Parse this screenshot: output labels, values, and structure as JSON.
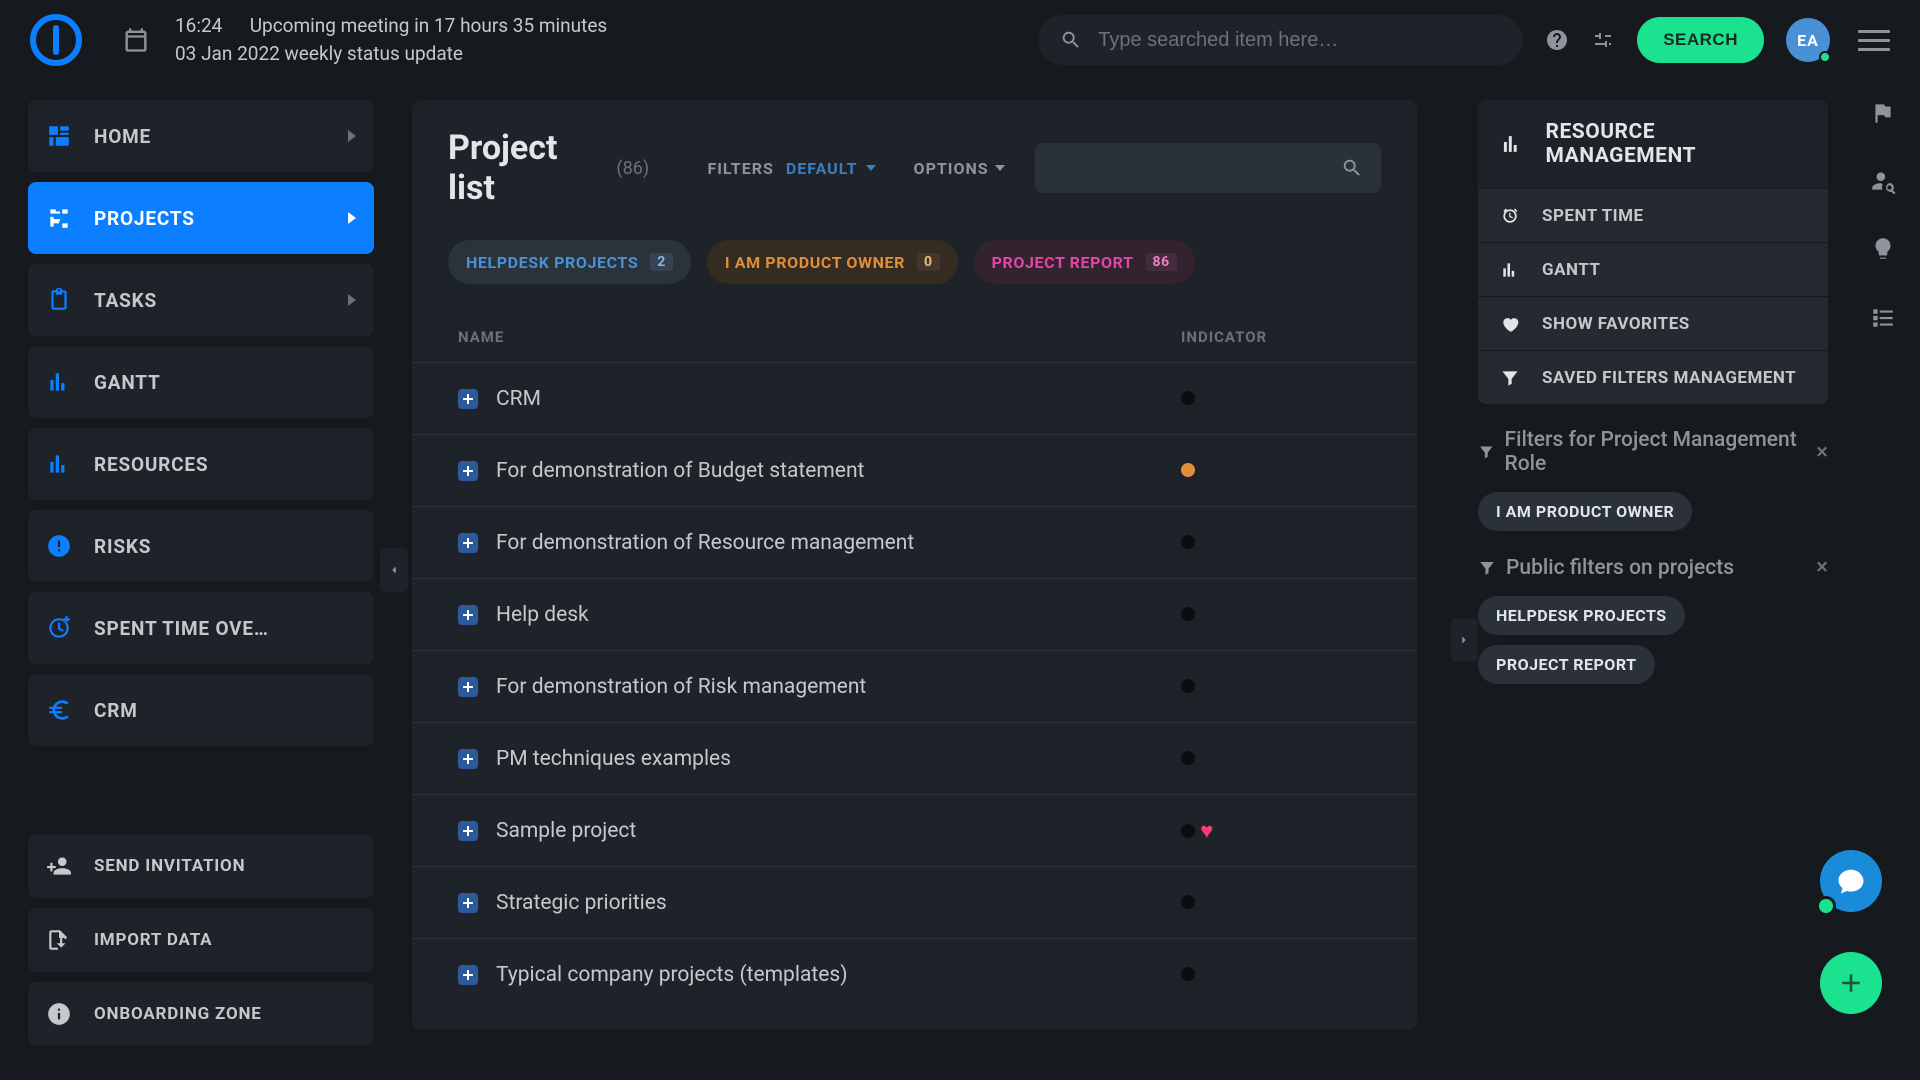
{
  "header": {
    "time": "16:24",
    "upcoming_label": "Upcoming meeting in 17 hours 35 minutes",
    "date": "03 Jan 2022",
    "meeting_title": "weekly status update",
    "search_placeholder": "Type searched item here…",
    "search_button": "SEARCH",
    "avatar_initials": "EA"
  },
  "sidebar": {
    "items": [
      {
        "label": "HOME",
        "icon": "grid",
        "submenu": true
      },
      {
        "label": "PROJECTS",
        "icon": "tree",
        "submenu": true,
        "active": true
      },
      {
        "label": "TASKS",
        "icon": "clipboard",
        "submenu": true
      },
      {
        "label": "GANTT",
        "icon": "bars"
      },
      {
        "label": "RESOURCES",
        "icon": "bars"
      },
      {
        "label": "RISKS",
        "icon": "alert"
      },
      {
        "label": "SPENT TIME OVE…",
        "icon": "clock-plus"
      },
      {
        "label": "CRM",
        "icon": "euro"
      }
    ],
    "footer": [
      {
        "label": "SEND INVITATION",
        "icon": "person-plus"
      },
      {
        "label": "IMPORT DATA",
        "icon": "import"
      },
      {
        "label": "ONBOARDING ZONE",
        "icon": "info"
      }
    ]
  },
  "main": {
    "title": "Project list",
    "count_display": "(86)",
    "filters_label": "FILTERS",
    "filters_value": "DEFAULT",
    "options_label": "OPTIONS",
    "chips": [
      {
        "label": "HELPDESK PROJECTS",
        "count": "2",
        "color": "blue"
      },
      {
        "label": "I AM PRODUCT OWNER",
        "count": "0",
        "color": "orange"
      },
      {
        "label": "PROJECT REPORT",
        "count": "86",
        "color": "pink"
      }
    ],
    "columns": {
      "name": "NAME",
      "indicator": "INDICATOR"
    },
    "rows": [
      {
        "name": "CRM",
        "indicator": "black"
      },
      {
        "name": "For demonstration of Budget statement",
        "indicator": "orange"
      },
      {
        "name": "For demonstration of Resource management",
        "indicator": "black"
      },
      {
        "name": "Help desk",
        "indicator": "black"
      },
      {
        "name": "For demonstration of Risk management",
        "indicator": "black"
      },
      {
        "name": "PM techniques examples",
        "indicator": "black"
      },
      {
        "name": "Sample project",
        "indicator": "black",
        "favorite": true
      },
      {
        "name": "Strategic priorities",
        "indicator": "black"
      },
      {
        "name": "Typical company projects (templates)",
        "indicator": "black"
      }
    ]
  },
  "right": {
    "card_title": "RESOURCE MANAGEMENT",
    "items": [
      {
        "label": "SPENT TIME",
        "icon": "alarm"
      },
      {
        "label": "GANTT",
        "icon": "bars"
      },
      {
        "label": "SHOW FAVORITES",
        "icon": "heart"
      },
      {
        "label": "SAVED FILTERS MANAGEMENT",
        "icon": "funnel"
      }
    ],
    "filter_blocks": [
      {
        "title": "Filters for Project Management Role",
        "tags": [
          "I AM PRODUCT OWNER"
        ]
      },
      {
        "title": "Public filters on projects",
        "tags": [
          "HELPDESK PROJECTS",
          "PROJECT REPORT"
        ]
      }
    ]
  }
}
